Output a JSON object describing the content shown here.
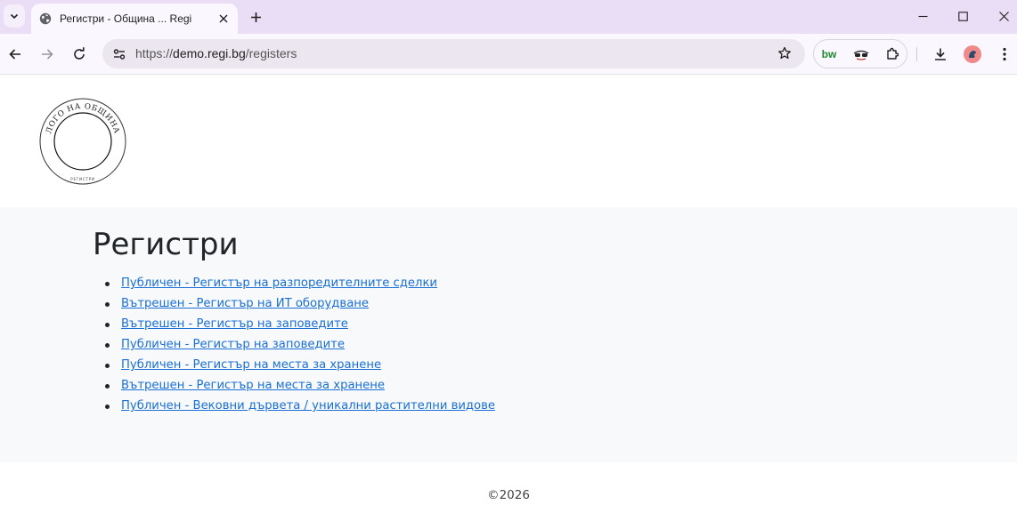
{
  "browser": {
    "tab_title": "Регистри - Община ... Regi",
    "url_scheme": "https://",
    "url_host": "demo.regi.bg",
    "url_path": "/registers",
    "extension_bw_label": "bw"
  },
  "page": {
    "logo_top_text": "ЛОГО НА ОБЩИНА",
    "logo_bottom_text": "РЕГИСТРИ",
    "heading": "Регистри",
    "registers": [
      "Публичен - Регистър на разпоредителните сделки",
      "Вътрешен - Регистър на ИТ оборудване",
      "Вътрешен - Регистър на заповедите",
      "Публичен - Регистър на заповедите",
      "Публичен - Регистър на места за хранене",
      "Вътрешен - Регистър на места за хранене",
      "Публичен - Вековни дървета / уникални растителни видове"
    ],
    "footer": "©2026"
  },
  "colors": {
    "tabbar_bg": "#e9def5",
    "toolbar_bg": "#fbf7ff",
    "link": "#1a6fd6",
    "content_bg": "#f8f9fa"
  }
}
